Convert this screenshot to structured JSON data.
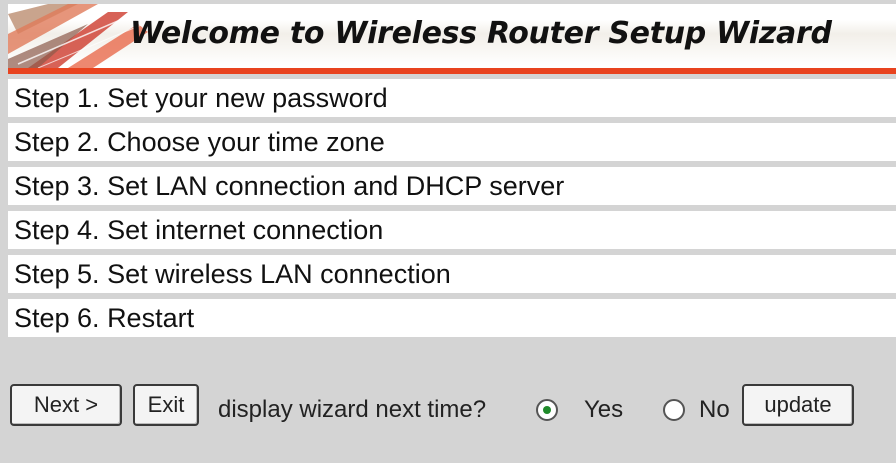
{
  "header": {
    "title": "Welcome to Wireless Router Setup Wizard"
  },
  "steps": [
    "Step 1. Set your new password",
    "Step 2. Choose your time zone",
    "Step 3. Set LAN connection and DHCP server",
    "Step 4. Set internet connection",
    "Step 5. Set wireless LAN connection",
    "Step 6. Restart"
  ],
  "controls": {
    "next_label": "Next >",
    "exit_label": "Exit",
    "question": "display wizard next time?",
    "yes_label": "Yes",
    "no_label": "No",
    "update_label": "update",
    "selected": "Yes"
  },
  "colors": {
    "accent": "#e8431f",
    "background": "#d4d4d4"
  }
}
